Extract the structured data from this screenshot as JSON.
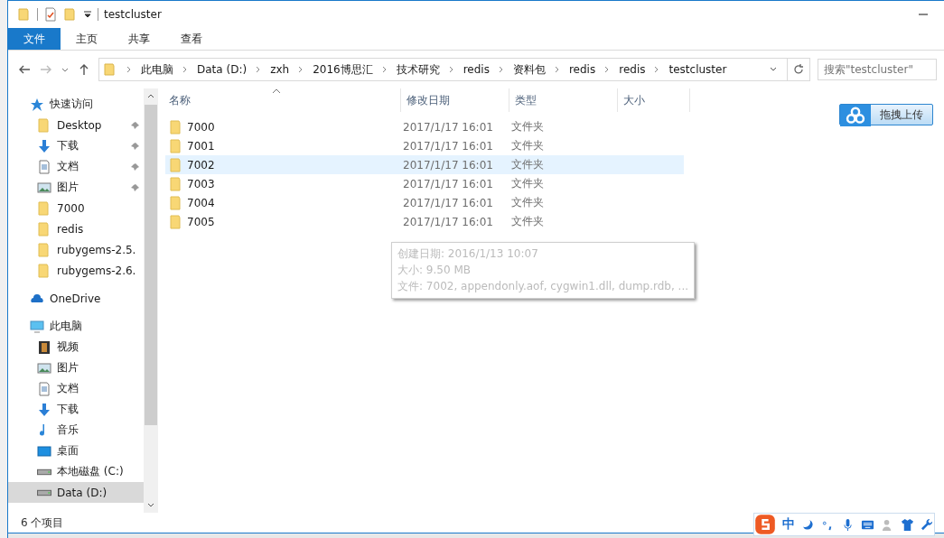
{
  "window": {
    "title": "testcluster"
  },
  "ribbon_tabs": [
    {
      "label": "文件",
      "kind": "file"
    },
    {
      "label": "主页",
      "kind": "tab"
    },
    {
      "label": "共享",
      "kind": "tab"
    },
    {
      "label": "查看",
      "kind": "tab"
    }
  ],
  "address_bar": {
    "segments": [
      "此电脑",
      "Data (D:)",
      "zxh",
      "2016博思汇",
      "技术研究",
      "redis",
      "资料包",
      "redis",
      "redis",
      "testcluster"
    ]
  },
  "search": {
    "placeholder": "搜索\"testcluster\""
  },
  "sidebar": {
    "sections": [
      {
        "label": "快速访问",
        "kind": "star",
        "children": [
          {
            "label": "Desktop",
            "kind": "folder",
            "pinned": true,
            "selected": false
          },
          {
            "label": "下载",
            "kind": "download",
            "pinned": true,
            "selected": false
          },
          {
            "label": "文档",
            "kind": "document",
            "pinned": true,
            "selected": false
          },
          {
            "label": "图片",
            "kind": "picture",
            "pinned": true,
            "selected": false
          },
          {
            "label": "7000",
            "kind": "folder",
            "pinned": false,
            "selected": false
          },
          {
            "label": "redis",
            "kind": "folder",
            "pinned": false,
            "selected": false
          },
          {
            "label": "rubygems-2.5.",
            "kind": "folder",
            "pinned": false,
            "selected": false
          },
          {
            "label": "rubygems-2.6.",
            "kind": "folder",
            "pinned": false,
            "selected": false
          }
        ]
      },
      {
        "label": "OneDrive",
        "kind": "cloud"
      },
      {
        "label": "此电脑",
        "kind": "pc",
        "children": [
          {
            "label": "视频",
            "kind": "video",
            "pinned": false,
            "selected": false
          },
          {
            "label": "图片",
            "kind": "picture",
            "pinned": false,
            "selected": false
          },
          {
            "label": "文档",
            "kind": "document",
            "pinned": false,
            "selected": false
          },
          {
            "label": "下载",
            "kind": "download",
            "pinned": false,
            "selected": false
          },
          {
            "label": "音乐",
            "kind": "music",
            "pinned": false,
            "selected": false
          },
          {
            "label": "桌面",
            "kind": "desktop",
            "pinned": false,
            "selected": false
          },
          {
            "label": "本地磁盘 (C:)",
            "kind": "drive",
            "pinned": false,
            "selected": false
          },
          {
            "label": "Data (D:)",
            "kind": "drive",
            "pinned": false,
            "selected": true
          }
        ]
      }
    ]
  },
  "table": {
    "columns": [
      {
        "label": "名称",
        "sorted": true
      },
      {
        "label": "修改日期",
        "sorted": false
      },
      {
        "label": "类型",
        "sorted": false
      },
      {
        "label": "大小",
        "sorted": false
      }
    ],
    "rows": [
      {
        "name": "7000",
        "date": "2017/1/17 16:01",
        "type": "文件夹",
        "hovered": false
      },
      {
        "name": "7001",
        "date": "2017/1/17 16:01",
        "type": "文件夹",
        "hovered": false
      },
      {
        "name": "7002",
        "date": "2017/1/17 16:01",
        "type": "文件夹",
        "hovered": true
      },
      {
        "name": "7003",
        "date": "2017/1/17 16:01",
        "type": "文件夹",
        "hovered": false
      },
      {
        "name": "7004",
        "date": "2017/1/17 16:01",
        "type": "文件夹",
        "hovered": false
      },
      {
        "name": "7005",
        "date": "2017/1/17 16:01",
        "type": "文件夹",
        "hovered": false
      }
    ]
  },
  "tooltip": {
    "lines": [
      "创建日期: 2016/1/13 10:07",
      "大小: 9.50 MB",
      "文件: 7002, appendonly.aof, cygwin1.dll, dump.rdb, ..."
    ]
  },
  "upload_button": {
    "label": "拖拽上传"
  },
  "status_bar": {
    "item_count": "6 个项目"
  },
  "ime_toolbar": {
    "mode": "中"
  }
}
